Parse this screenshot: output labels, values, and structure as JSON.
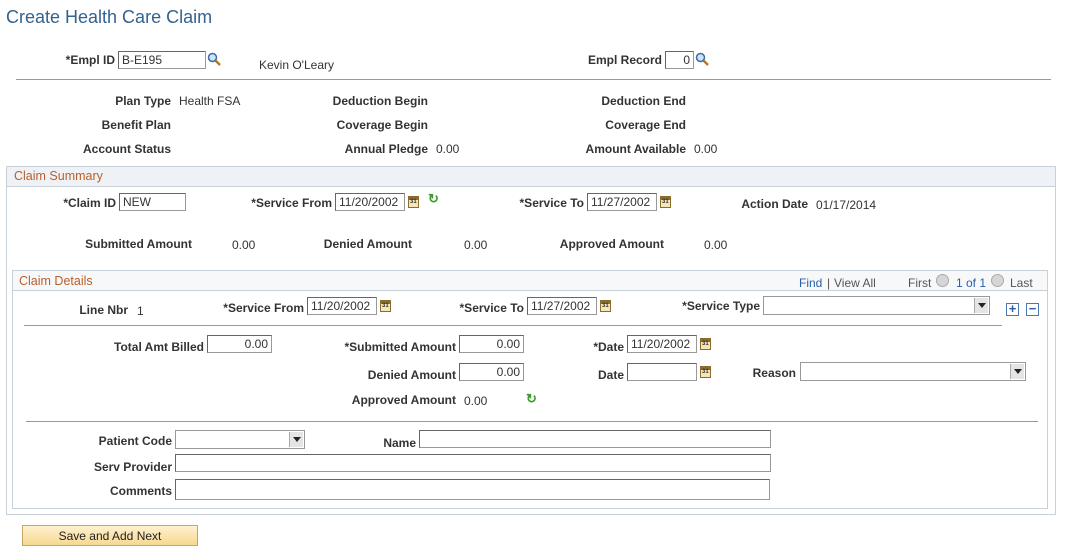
{
  "page_title": "Create Health Care Claim",
  "header": {
    "empl_id_label": "*Empl ID",
    "empl_id_value": "B-E195",
    "empl_name": "Kevin O'Leary",
    "empl_record_label": "Empl Record",
    "empl_record_value": "0"
  },
  "plan": {
    "plan_type_label": "Plan Type",
    "plan_type_value": "Health FSA",
    "deduction_begin_label": "Deduction Begin",
    "deduction_end_label": "Deduction End",
    "benefit_plan_label": "Benefit Plan",
    "coverage_begin_label": "Coverage Begin",
    "coverage_end_label": "Coverage End",
    "account_status_label": "Account Status",
    "annual_pledge_label": "Annual Pledge",
    "annual_pledge_value": "0.00",
    "amount_available_label": "Amount Available",
    "amount_available_value": "0.00"
  },
  "claim_summary": {
    "title": "Claim Summary",
    "claim_id_label": "*Claim ID",
    "claim_id_value": "NEW",
    "service_from_label": "*Service From",
    "service_from_value": "11/20/2002",
    "service_to_label": "*Service To",
    "service_to_value": "11/27/2002",
    "action_date_label": "Action Date",
    "action_date_value": "01/17/2014",
    "submitted_amount_label": "Submitted Amount",
    "submitted_amount_value": "0.00",
    "denied_amount_label": "Denied Amount",
    "denied_amount_value": "0.00",
    "approved_amount_label": "Approved Amount",
    "approved_amount_value": "0.00"
  },
  "claim_details": {
    "title": "Claim Details",
    "find_link": "Find",
    "separator": "|",
    "view_all_link": "View All",
    "first_label": "First",
    "page_indicator": "1 of 1",
    "last_label": "Last",
    "line_nbr_label": "Line Nbr",
    "line_nbr_value": "1",
    "service_from_label": "*Service From",
    "service_from_value": "11/20/2002",
    "service_to_label": "*Service To",
    "service_to_value": "11/27/2002",
    "service_type_label": "*Service Type",
    "service_type_value": "",
    "add_symbol": "+",
    "remove_symbol": "−",
    "total_amt_billed_label": "Total Amt Billed",
    "total_amt_billed_value": "0.00",
    "submitted_amount_label": "*Submitted Amount",
    "submitted_amount_value": "0.00",
    "date_label": "*Date",
    "date_value": "11/20/2002",
    "denied_amount_label": "Denied Amount",
    "denied_amount_value": "0.00",
    "denied_date_label": "Date",
    "denied_date_value": "",
    "reason_label": "Reason",
    "reason_value": "",
    "approved_amount_label": "Approved Amount",
    "approved_amount_value": "0.00",
    "patient_code_label": "Patient Code",
    "patient_code_value": "",
    "name_label": "Name",
    "name_value": "",
    "serv_provider_label": "Serv Provider",
    "serv_provider_value": "",
    "comments_label": "Comments",
    "comments_value": ""
  },
  "save_button_label": "Save and Add Next"
}
